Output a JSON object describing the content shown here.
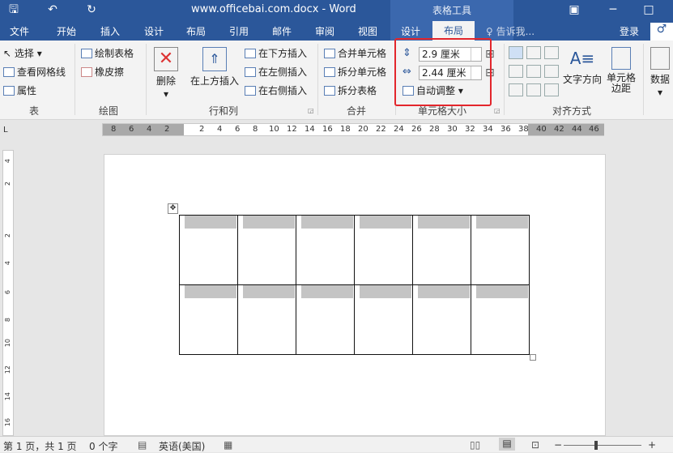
{
  "title": {
    "text": "www.officebai.com.docx - Word",
    "context_tools": "表格工具"
  },
  "menu": {
    "file": "文件",
    "home": "开始",
    "insert": "插入",
    "design": "设计",
    "layout": "布局",
    "references": "引用",
    "mailings": "邮件",
    "review": "审阅",
    "view": "视图",
    "ctx_design": "设计",
    "ctx_layout": "布局",
    "tell_me": "♀ 告诉我...",
    "login": "登录"
  },
  "ribbon": {
    "table": {
      "select": "选择",
      "gridlines": "查看网格线",
      "properties": "属性",
      "label": "表"
    },
    "draw": {
      "draw_table": "绘制表格",
      "eraser": "橡皮擦",
      "label": "绘图"
    },
    "rows": {
      "delete": "删除",
      "insert_above": "在上方插入",
      "insert_below": "在下方插入",
      "insert_left": "在左侧插入",
      "insert_right": "在右侧插入",
      "label": "行和列"
    },
    "merge": {
      "merge_cells": "合并单元格",
      "split_cells": "拆分单元格",
      "split_table": "拆分表格",
      "label": "合并"
    },
    "cellsize": {
      "height": "2.9 厘米",
      "width": "2.44 厘米",
      "autofit": "自动调整",
      "label": "单元格大小"
    },
    "align": {
      "text_direction": "文字方向",
      "cell_margins": "单元格边距",
      "label": "对齐方式"
    },
    "data": {
      "label": "数据"
    }
  },
  "ruler": {
    "h_numbers": [
      "8",
      "6",
      "4",
      "2",
      "2",
      "4",
      "6",
      "8",
      "10",
      "12",
      "14",
      "16",
      "18",
      "20",
      "22",
      "24",
      "26",
      "28",
      "30",
      "32",
      "34",
      "36",
      "38",
      "40",
      "42",
      "44",
      "46"
    ],
    "v_numbers": [
      "4",
      "2",
      "2",
      "4",
      "6",
      "8",
      "10",
      "12",
      "14",
      "16",
      "18"
    ],
    "corner": "L"
  },
  "status": {
    "page": "第 1 页，共 1 页",
    "words": "0 个字",
    "lang": "英语(美国)"
  }
}
